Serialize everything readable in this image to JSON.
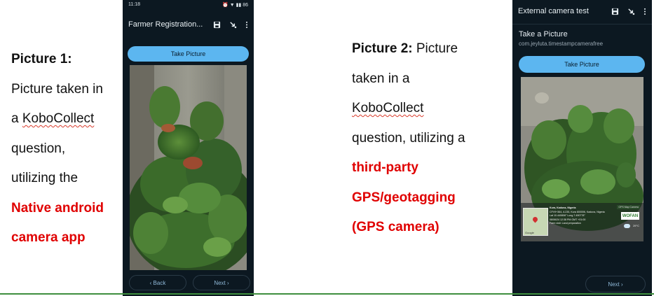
{
  "captions": {
    "left": {
      "lines": [
        "Picture 1:",
        "Picture taken in",
        "a",
        "KoboCollect",
        "question,",
        "utilizing the",
        "Native android",
        "camera app"
      ]
    },
    "right": {
      "lines": [
        "Picture 2:",
        "Picture",
        "taken in a",
        "KoboCollect",
        "question, utilizing a",
        "third-party",
        "GPS/geotagging",
        "(GPS camera)"
      ]
    }
  },
  "phone1": {
    "status_time": "11:18",
    "status_right": "⏰ ▼ ▮▮ 86",
    "app_title": "Farmer Registration...",
    "take_picture_label": "Take Picture",
    "back_label": "Back",
    "next_label": "Next",
    "icons": [
      "save-icon",
      "jump-icon",
      "more-icon"
    ]
  },
  "phone2": {
    "app_title": "External camera test",
    "question_label": "Take a Picture",
    "question_hint": "com.jeyluta.timestampcamerafree",
    "take_picture_label": "Take Picture",
    "next_label": "Next",
    "overlay": {
      "line1": "Kura, Kaduna, Nigeria",
      "line2": "CFV9+364, A 235, Kura 800006, Kaduna, Nigeria",
      "line3": "Lat 10.440806° Long 7.490778°",
      "line4": "08/06/24 12:38 PM GMT +01:00",
      "line5": "Farm visit: Land preparation",
      "map_label": "Google",
      "app_tag": "GPS Map Camera",
      "brand": "WOFAN",
      "temp": "29°C"
    },
    "icons": [
      "save-icon",
      "jump-icon",
      "more-icon"
    ]
  },
  "colors": {
    "accent_red": "#e00000",
    "phone_bg": "#0c1821",
    "button_blue": "#5cb6f0",
    "bottom_line": "#3e8e3e"
  }
}
